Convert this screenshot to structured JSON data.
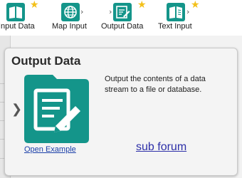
{
  "palette": {
    "tools": [
      {
        "label": "Input Data",
        "icon": "book-icon",
        "starred": true
      },
      {
        "label": "Map Input",
        "icon": "globe-icon",
        "starred": false
      },
      {
        "label": "Output Data",
        "icon": "notepad-pencil-icon",
        "starred": true
      },
      {
        "label": "Text Input",
        "icon": "text-book-icon",
        "starred": true
      }
    ]
  },
  "tooltip": {
    "title": "Output Data",
    "description": "Output the contents of a data stream to a file or database.",
    "example_link": "Open Example",
    "forum_link": "sub forum"
  },
  "colors": {
    "tool_accent": "#14958a",
    "star": "#f3c01a",
    "link": "#1a3ea8"
  }
}
